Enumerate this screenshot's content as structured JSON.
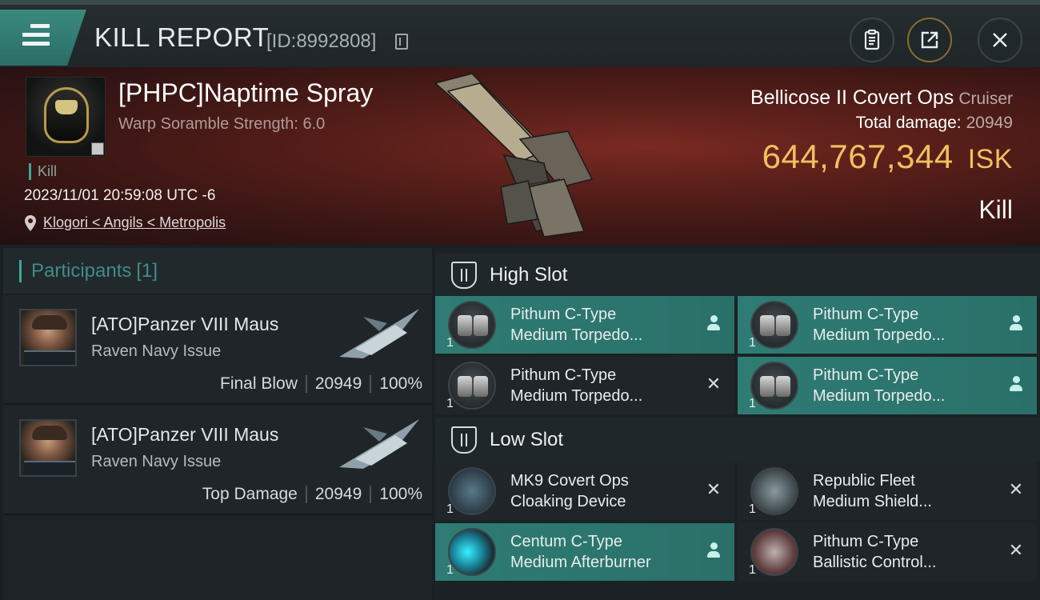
{
  "header": {
    "title": "KILL REPORT",
    "report_id": "[ID:8992808]",
    "buttons": {
      "clipboard_icon": "clipboard-icon",
      "share_icon": "share-icon",
      "close_icon": "close-icon"
    }
  },
  "victim": {
    "name": "[PHPC]Naptime Spray",
    "warp_scramble": "Warp Soramble Strength: 6.0",
    "kill_tag": "Kill",
    "datetime": "2023/11/01 20:59:08 UTC -6",
    "location": "Klogori < Angils < Metropolis"
  },
  "ship": {
    "name": "Bellicose II Covert Ops",
    "class": "Cruiser",
    "total_damage_label": "Total damage:",
    "total_damage_value": "20949",
    "isk_value": "644,767,344",
    "isk_unit": "ISK",
    "result": "Kill"
  },
  "participants": {
    "label": "Participants",
    "count": "[1]",
    "rows": [
      {
        "name": "[ATO]Panzer VIII Maus",
        "ship": "Raven Navy Issue",
        "role": "Final Blow",
        "damage": "20949",
        "percent": "100%"
      },
      {
        "name": "[ATO]Panzer VIII Maus",
        "ship": "Raven Navy Issue",
        "role": "Top Damage",
        "damage": "20949",
        "percent": "100%"
      }
    ]
  },
  "slots": {
    "high": {
      "label": "High Slot",
      "items": [
        {
          "line1": "Pithum C-Type",
          "line2": "Medium Torpedo...",
          "qty": "1",
          "status": "dropped"
        },
        {
          "line1": "Pithum C-Type",
          "line2": "Medium Torpedo...",
          "qty": "1",
          "status": "dropped"
        },
        {
          "line1": "Pithum C-Type",
          "line2": "Medium Torpedo...",
          "qty": "1",
          "status": "destroyed"
        },
        {
          "line1": "Pithum C-Type",
          "line2": "Medium Torpedo...",
          "qty": "1",
          "status": "dropped"
        }
      ]
    },
    "low": {
      "label": "Low Slot",
      "items": [
        {
          "line1": "MK9 Covert Ops",
          "line2": "Cloaking Device",
          "qty": "1",
          "status": "destroyed"
        },
        {
          "line1": "Republic Fleet",
          "line2": "Medium Shield...",
          "qty": "1",
          "status": "destroyed"
        },
        {
          "line1": "Centum C-Type",
          "line2": "Medium Afterburner",
          "qty": "1",
          "status": "dropped"
        },
        {
          "line1": "Pithum C-Type",
          "line2": "Ballistic Control...",
          "qty": "1",
          "status": "destroyed"
        }
      ]
    }
  },
  "colors": {
    "accent": "#2e7c74",
    "isk": "#f0c060",
    "banner": "#5a1f1a"
  }
}
